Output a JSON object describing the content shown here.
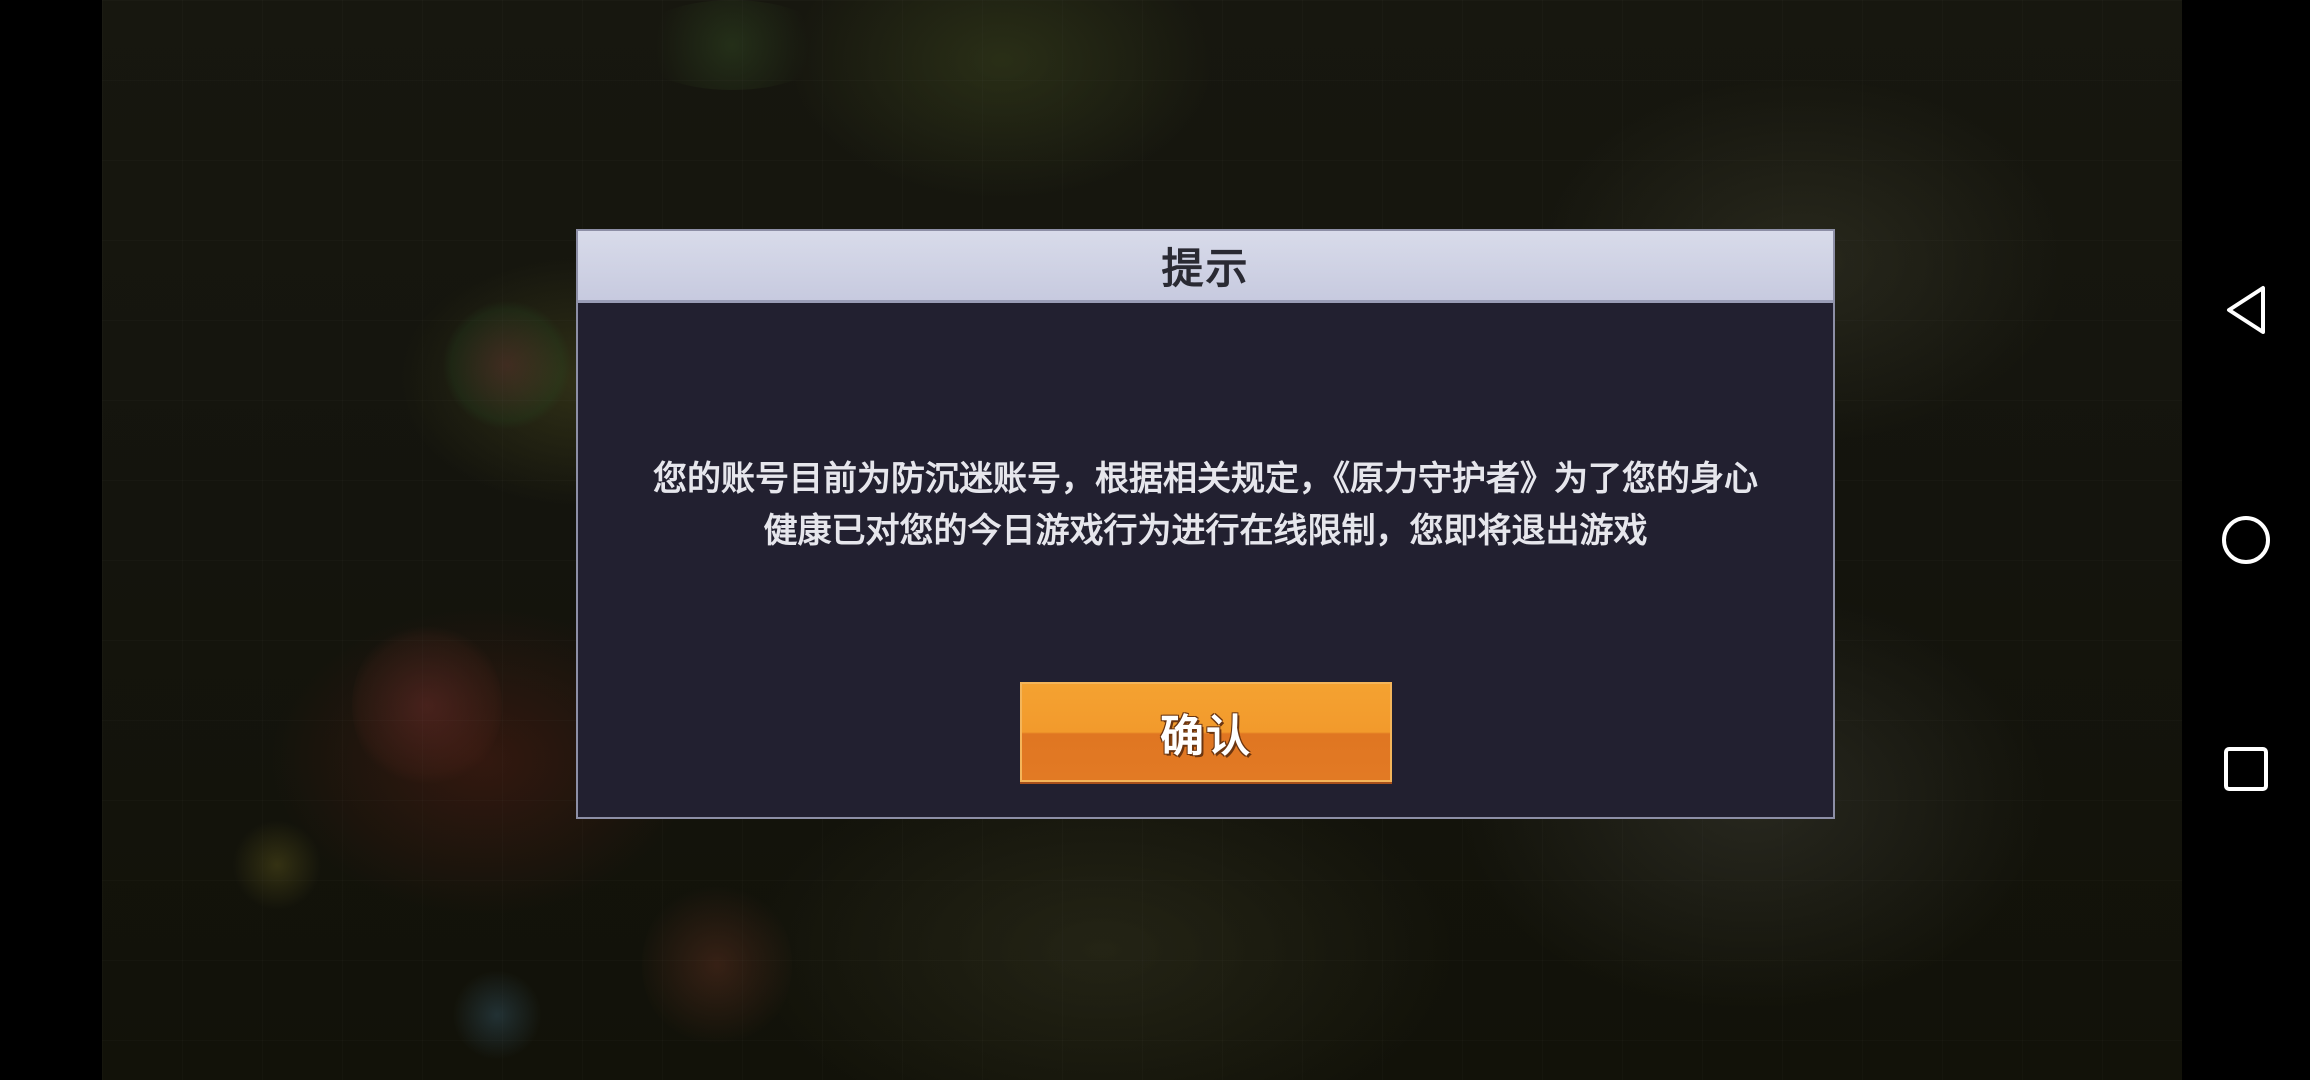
{
  "dialog": {
    "title": "提示",
    "message_line1": "您的账号目前为防沉迷账号，根据相关规定，《原力守护者》为了您的身心",
    "message_line2": "健康已对您的今日游戏行为进行在线限制，您即将退出游戏",
    "confirm_label": "确认"
  },
  "navbar": {
    "back_icon": "back-triangle-icon",
    "home_icon": "home-circle-icon",
    "recents_icon": "recents-square-icon"
  },
  "colors": {
    "header_bg": "#cdd0e2",
    "dialog_bg": "#222030",
    "button_orange": "#f29a2c",
    "nav_icon": "#ffffff"
  }
}
